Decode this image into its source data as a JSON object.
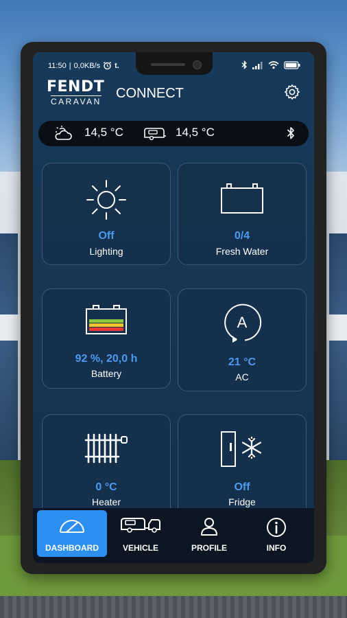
{
  "status_bar": {
    "time": "11:50",
    "separator": "|",
    "data_rate": "0,0KB/s",
    "extra": "t."
  },
  "header": {
    "brand_name": "FENDT",
    "brand_sub": "CARAVAN",
    "app_name": "CONNECT"
  },
  "weather_bar": {
    "outside_temp": "14,5 °C",
    "caravan_temp": "14,5 °C"
  },
  "tiles": [
    {
      "value": "Off",
      "label": "Lighting",
      "icon": "sun-icon"
    },
    {
      "value": "0/4",
      "label": "Fresh Water",
      "icon": "water-tank-icon"
    },
    {
      "value": "92 %, 20,0 h",
      "label": "Battery",
      "icon": "battery-icon"
    },
    {
      "value": "21 °C",
      "label": "AC",
      "icon": "ac-icon"
    },
    {
      "value": "0 °C",
      "label": "Heater",
      "icon": "radiator-icon"
    },
    {
      "value": "Off",
      "label": "Fridge",
      "icon": "fridge-icon"
    }
  ],
  "nav": [
    {
      "label": "DASHBOARD",
      "icon": "gauge-icon",
      "active": true
    },
    {
      "label": "VEHICLE",
      "icon": "caravan-icon",
      "active": false
    },
    {
      "label": "PROFILE",
      "icon": "person-icon",
      "active": false
    },
    {
      "label": "INFO",
      "icon": "info-icon",
      "active": false
    }
  ],
  "colors": {
    "accent": "#2d8ff0",
    "value_text": "#4a9bf0",
    "screen_bg": "#163654",
    "tile_border": "#3b5876"
  }
}
